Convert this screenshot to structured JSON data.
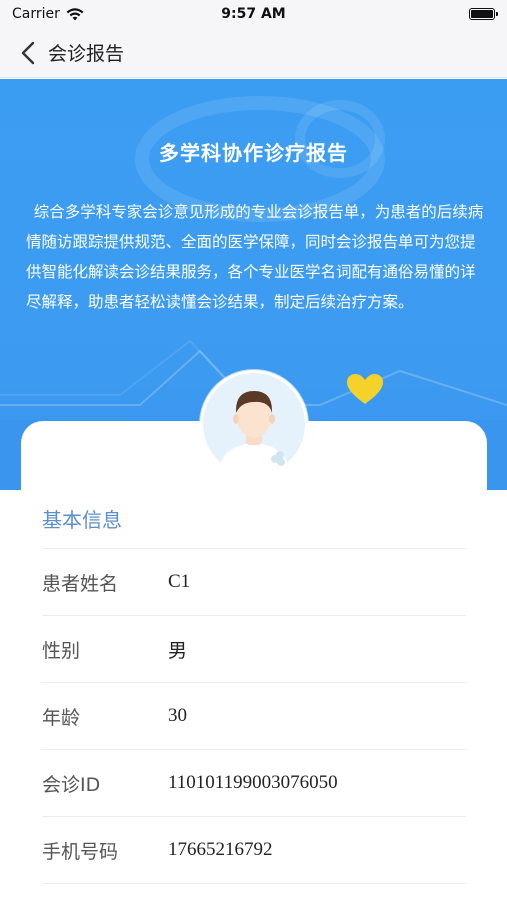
{
  "status_bar": {
    "carrier": "Carrier",
    "time": "9:57 AM"
  },
  "nav": {
    "title": "会诊报告"
  },
  "hero": {
    "title": "多学科协作诊疗报告",
    "description": "综合多学科专家会诊意见形成的专业会诊报告单，为患者的后续病情随访跟踪提供规范、全面的医学保障，同时会诊报告单可为您提供智能化解读会诊结果服务，各个专业医学名词配有通俗易懂的详尽解释，助患者轻松读懂会诊结果，制定后续治疗方案。"
  },
  "basic_info": {
    "section_title": "基本信息",
    "rows": [
      {
        "label": "患者姓名",
        "value": "C1"
      },
      {
        "label": "性别",
        "value": "男"
      },
      {
        "label": "年龄",
        "value": "30"
      },
      {
        "label": "会诊ID",
        "value": "110101199003076050"
      },
      {
        "label": "手机号码",
        "value": "17665216792"
      }
    ]
  },
  "colors": {
    "hero_blue": "#3b9df2",
    "section_title": "#5a8fcb",
    "heart": "#f5d22a"
  },
  "icons": [
    "wifi-icon",
    "battery-icon",
    "back-chevron-icon",
    "heart-icon",
    "avatar-icon"
  ]
}
